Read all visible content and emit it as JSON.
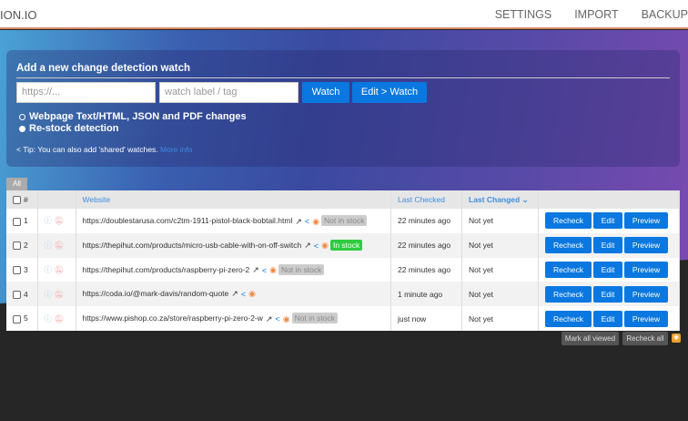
{
  "header": {
    "logo": "ION.IO",
    "nav": [
      "SETTINGS",
      "IMPORT",
      "BACKUP"
    ]
  },
  "form": {
    "title": "Add a new change detection watch",
    "url_placeholder": "https://...",
    "tag_placeholder": "watch label / tag",
    "watch": "Watch",
    "edit_watch": "Edit > Watch",
    "options": [
      "Webpage Text/HTML, JSON and PDF changes",
      "Re-stock detection"
    ],
    "tip": "Tip: You can also add 'shared' watches.",
    "more_info": "More info"
  },
  "tab_all": "All",
  "table": {
    "headers": {
      "num": "#",
      "website": "Website",
      "last_checked": "Last Checked",
      "last_changed": "Last Changed"
    },
    "rows": [
      {
        "n": "1",
        "url": "https://doublestarusa.com/c2tm-1911-pistol-black-bobtail.html",
        "stock": "Not in stock",
        "in": false,
        "checked": "22 minutes ago",
        "changed": "Not yet"
      },
      {
        "n": "2",
        "url": "https://thepihut.com/products/micro-usb-cable-with-on-off-switch",
        "stock": "In stock",
        "in": true,
        "checked": "22 minutes ago",
        "changed": "Not yet"
      },
      {
        "n": "3",
        "url": "https://thepihut.com/products/raspberry-pi-zero-2",
        "stock": "Not in stock",
        "in": false,
        "checked": "22 minutes ago",
        "changed": "Not yet"
      },
      {
        "n": "4",
        "url": "https://coda.io/@mark-davis/random-quote",
        "stock": null,
        "in": false,
        "checked": "1 minute ago",
        "changed": "Not yet"
      },
      {
        "n": "5",
        "url": "https://www.pishop.co.za/store/raspberry-pi-zero-2-w",
        "stock": "Not in stock",
        "in": false,
        "checked": "just now",
        "changed": "Not yet"
      }
    ],
    "actions": {
      "recheck": "Recheck",
      "edit": "Edit",
      "preview": "Preview"
    }
  },
  "footer": {
    "mark_all": "Mark all viewed",
    "recheck_all": "Recheck all"
  }
}
